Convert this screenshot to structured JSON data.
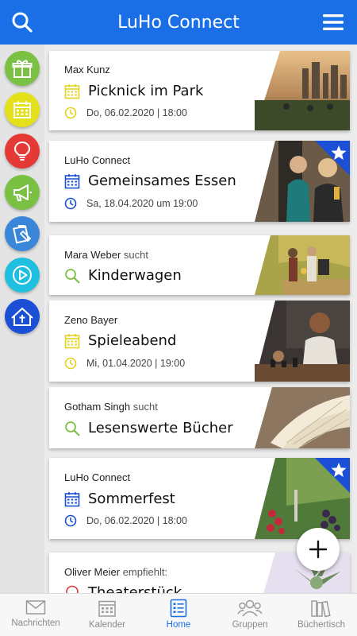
{
  "header": {
    "title": "LuHo Connect"
  },
  "rail": [
    {
      "name": "gift",
      "color": "#7ac043"
    },
    {
      "name": "calendar",
      "color": "#e4e11b"
    },
    {
      "name": "lightbulb",
      "color": "#e53935"
    },
    {
      "name": "megaphone",
      "color": "#7ac043"
    },
    {
      "name": "notes",
      "color": "#3a87d9"
    },
    {
      "name": "play",
      "color": "#1fbfe0"
    },
    {
      "name": "church",
      "color": "#1a4fd6"
    }
  ],
  "cards": [
    {
      "author": "Max Kunz",
      "suffix": "",
      "title": "Picknick im Park",
      "meta": "Do, 06.02.2020 | 18:00",
      "kind": "event-yellow",
      "featured": false
    },
    {
      "author": "LuHo Connect",
      "suffix": "",
      "title": "Gemeinsames Essen",
      "meta": "Sa, 18.04.2020 um 19:00",
      "kind": "event-blue",
      "featured": true
    },
    {
      "author": "Mara Weber",
      "suffix": "sucht",
      "title": "Kinderwagen",
      "meta": "",
      "kind": "search",
      "featured": false
    },
    {
      "author": "Zeno Bayer",
      "suffix": "",
      "title": "Spieleabend",
      "meta": "Mi, 01.04.2020 | 19:00",
      "kind": "event-yellow",
      "featured": false
    },
    {
      "author": "Gotham Singh",
      "suffix": "sucht",
      "title": "Lesenswerte Bücher",
      "meta": "",
      "kind": "search",
      "featured": false
    },
    {
      "author": "LuHo Connect",
      "suffix": "",
      "title": "Sommerfest",
      "meta": "Do, 06.02.2020 | 18:00",
      "kind": "event-blue",
      "featured": true
    },
    {
      "author": "Oliver Meier",
      "suffix": "empfiehlt:",
      "title": "Theaterstück",
      "meta": "",
      "kind": "recommend",
      "featured": false
    }
  ],
  "nav": [
    {
      "label": "Nachrichten",
      "icon": "envelope-icon",
      "active": false
    },
    {
      "label": "Kalender",
      "icon": "calendar-icon",
      "active": false
    },
    {
      "label": "Home",
      "icon": "list-icon",
      "active": true
    },
    {
      "label": "Gruppen",
      "icon": "group-icon",
      "active": false
    },
    {
      "label": "Büchertisch",
      "icon": "books-icon",
      "active": false
    }
  ],
  "colors": {
    "brand": "#1a6fe6",
    "event_yellow": "#e4d21b",
    "event_blue": "#1a4fd6",
    "search_green": "#7ac043",
    "recommend_red": "#e53935"
  }
}
